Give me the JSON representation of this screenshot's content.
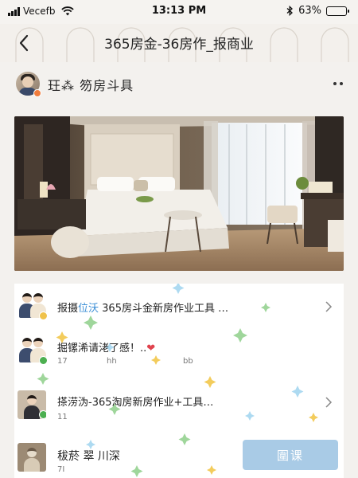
{
  "status_bar": {
    "carrier": "Vecefb",
    "time": "13:13 PM",
    "battery_text": "63%",
    "battery_level": 0.63
  },
  "nav": {
    "title": "365房金-36房作_报商业",
    "back_icon": "chevron-left-icon"
  },
  "post": {
    "author_name": "玨⁂  笏房斗具",
    "more_icon": "more-dots-icon"
  },
  "hero": {
    "image_subject": "bedroom interior"
  },
  "comments": [
    {
      "text_before": "报摄",
      "highlight": "位沃",
      "text_after": " 365房斗金新房作业工具 …",
      "meta": "",
      "meta2": ""
    },
    {
      "text_before": "掘镙浠请㳣了感！..",
      "highlight": "",
      "text_after": "",
      "heart": "❤",
      "meta": "17",
      "meta_mid": "hh",
      "meta2": "bb"
    },
    {
      "text_before": "搽涝沩-365淘房新房作业+工具…",
      "highlight": "",
      "text_after": "",
      "meta": "11",
      "meta2": ""
    },
    {
      "text_before": "秡菸 翠 川深",
      "highlight": "",
      "text_after": "",
      "meta": "7I",
      "meta2": ""
    }
  ],
  "follow_button": {
    "label": "圍课"
  },
  "colors": {
    "accent": "#3c8fd6",
    "button": "#a9cbe6",
    "badge_orange": "#f07c3c",
    "badge_green": "#4caf50"
  }
}
